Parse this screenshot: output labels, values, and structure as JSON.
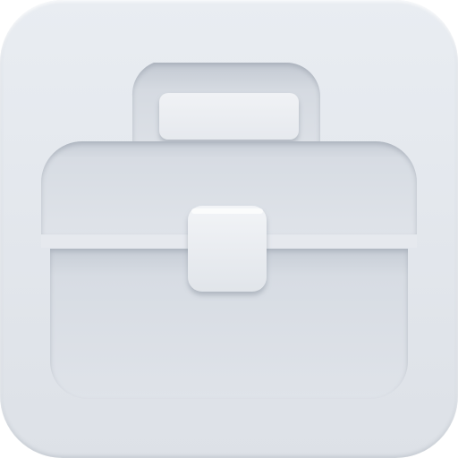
{
  "app_icon": {
    "icon": "briefcase-icon",
    "colors": {
      "tile": "#e3e7ec",
      "recess": "#d3d8df",
      "recess_shadow": "#aeb6c1",
      "highlight": "#ffffff",
      "clasp": "#e8ebf0"
    }
  }
}
